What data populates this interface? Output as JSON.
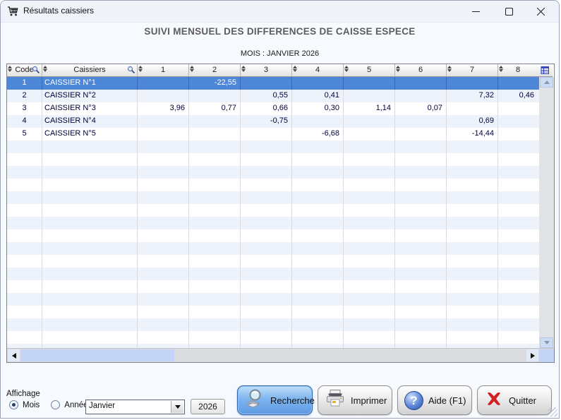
{
  "window": {
    "title": "Résultats caissiers"
  },
  "header": {
    "title": "SUIVI MENSUEL DES DIFFERENCES DE CAISSE ESPECE",
    "month_line": "MOIS : JANVIER 2026"
  },
  "table": {
    "headers": [
      {
        "label": "Code",
        "filter": true
      },
      {
        "label": "Caissiers",
        "filter": true
      },
      {
        "label": "1"
      },
      {
        "label": "2"
      },
      {
        "label": "3"
      },
      {
        "label": "4"
      },
      {
        "label": "5"
      },
      {
        "label": "6"
      },
      {
        "label": "7"
      },
      {
        "label": "8"
      }
    ],
    "rows": [
      {
        "code": "1",
        "name": "CAISSIER N°1",
        "values": [
          "",
          "-22,55",
          "",
          "",
          "",
          "",
          "",
          ""
        ],
        "selected": true
      },
      {
        "code": "2",
        "name": "CAISSIER N°2",
        "values": [
          "",
          "",
          "0,55",
          "0,41",
          "",
          "",
          "7,32",
          "0,46"
        ],
        "selected": false
      },
      {
        "code": "3",
        "name": "CAISSIER N°3",
        "values": [
          "3,96",
          "0,77",
          "0,66",
          "0,30",
          "1,14",
          "0,07",
          "",
          ""
        ],
        "selected": false
      },
      {
        "code": "4",
        "name": "CAISSIER N°4",
        "values": [
          "",
          "",
          "-0,75",
          "",
          "",
          "",
          "0,69",
          ""
        ],
        "selected": false
      },
      {
        "code": "5",
        "name": "CAISSIER N°5",
        "values": [
          "",
          "",
          "",
          "-6,68",
          "",
          "",
          "-14,44",
          ""
        ],
        "selected": false
      }
    ],
    "empty_row_count": 17
  },
  "footer": {
    "affichage_label": "Affichage",
    "radios": [
      {
        "label": "Mois",
        "selected": true
      },
      {
        "label": "Année",
        "selected": false
      }
    ],
    "month_value": "Janvier",
    "year_value": "2026",
    "buttons": [
      {
        "label": "Recherche",
        "primary": true
      },
      {
        "label": "Imprimer",
        "primary": false
      },
      {
        "label": "Aide (F1)",
        "primary": false
      },
      {
        "label": "Quitter",
        "primary": false
      }
    ]
  },
  "icons": {
    "help_glyph": "?"
  },
  "colors": {
    "selected_row": "#4E86D8",
    "row_alt": "#EEF2FB",
    "primary_button": "#5D9AE4",
    "quit_x": "#D42020"
  }
}
